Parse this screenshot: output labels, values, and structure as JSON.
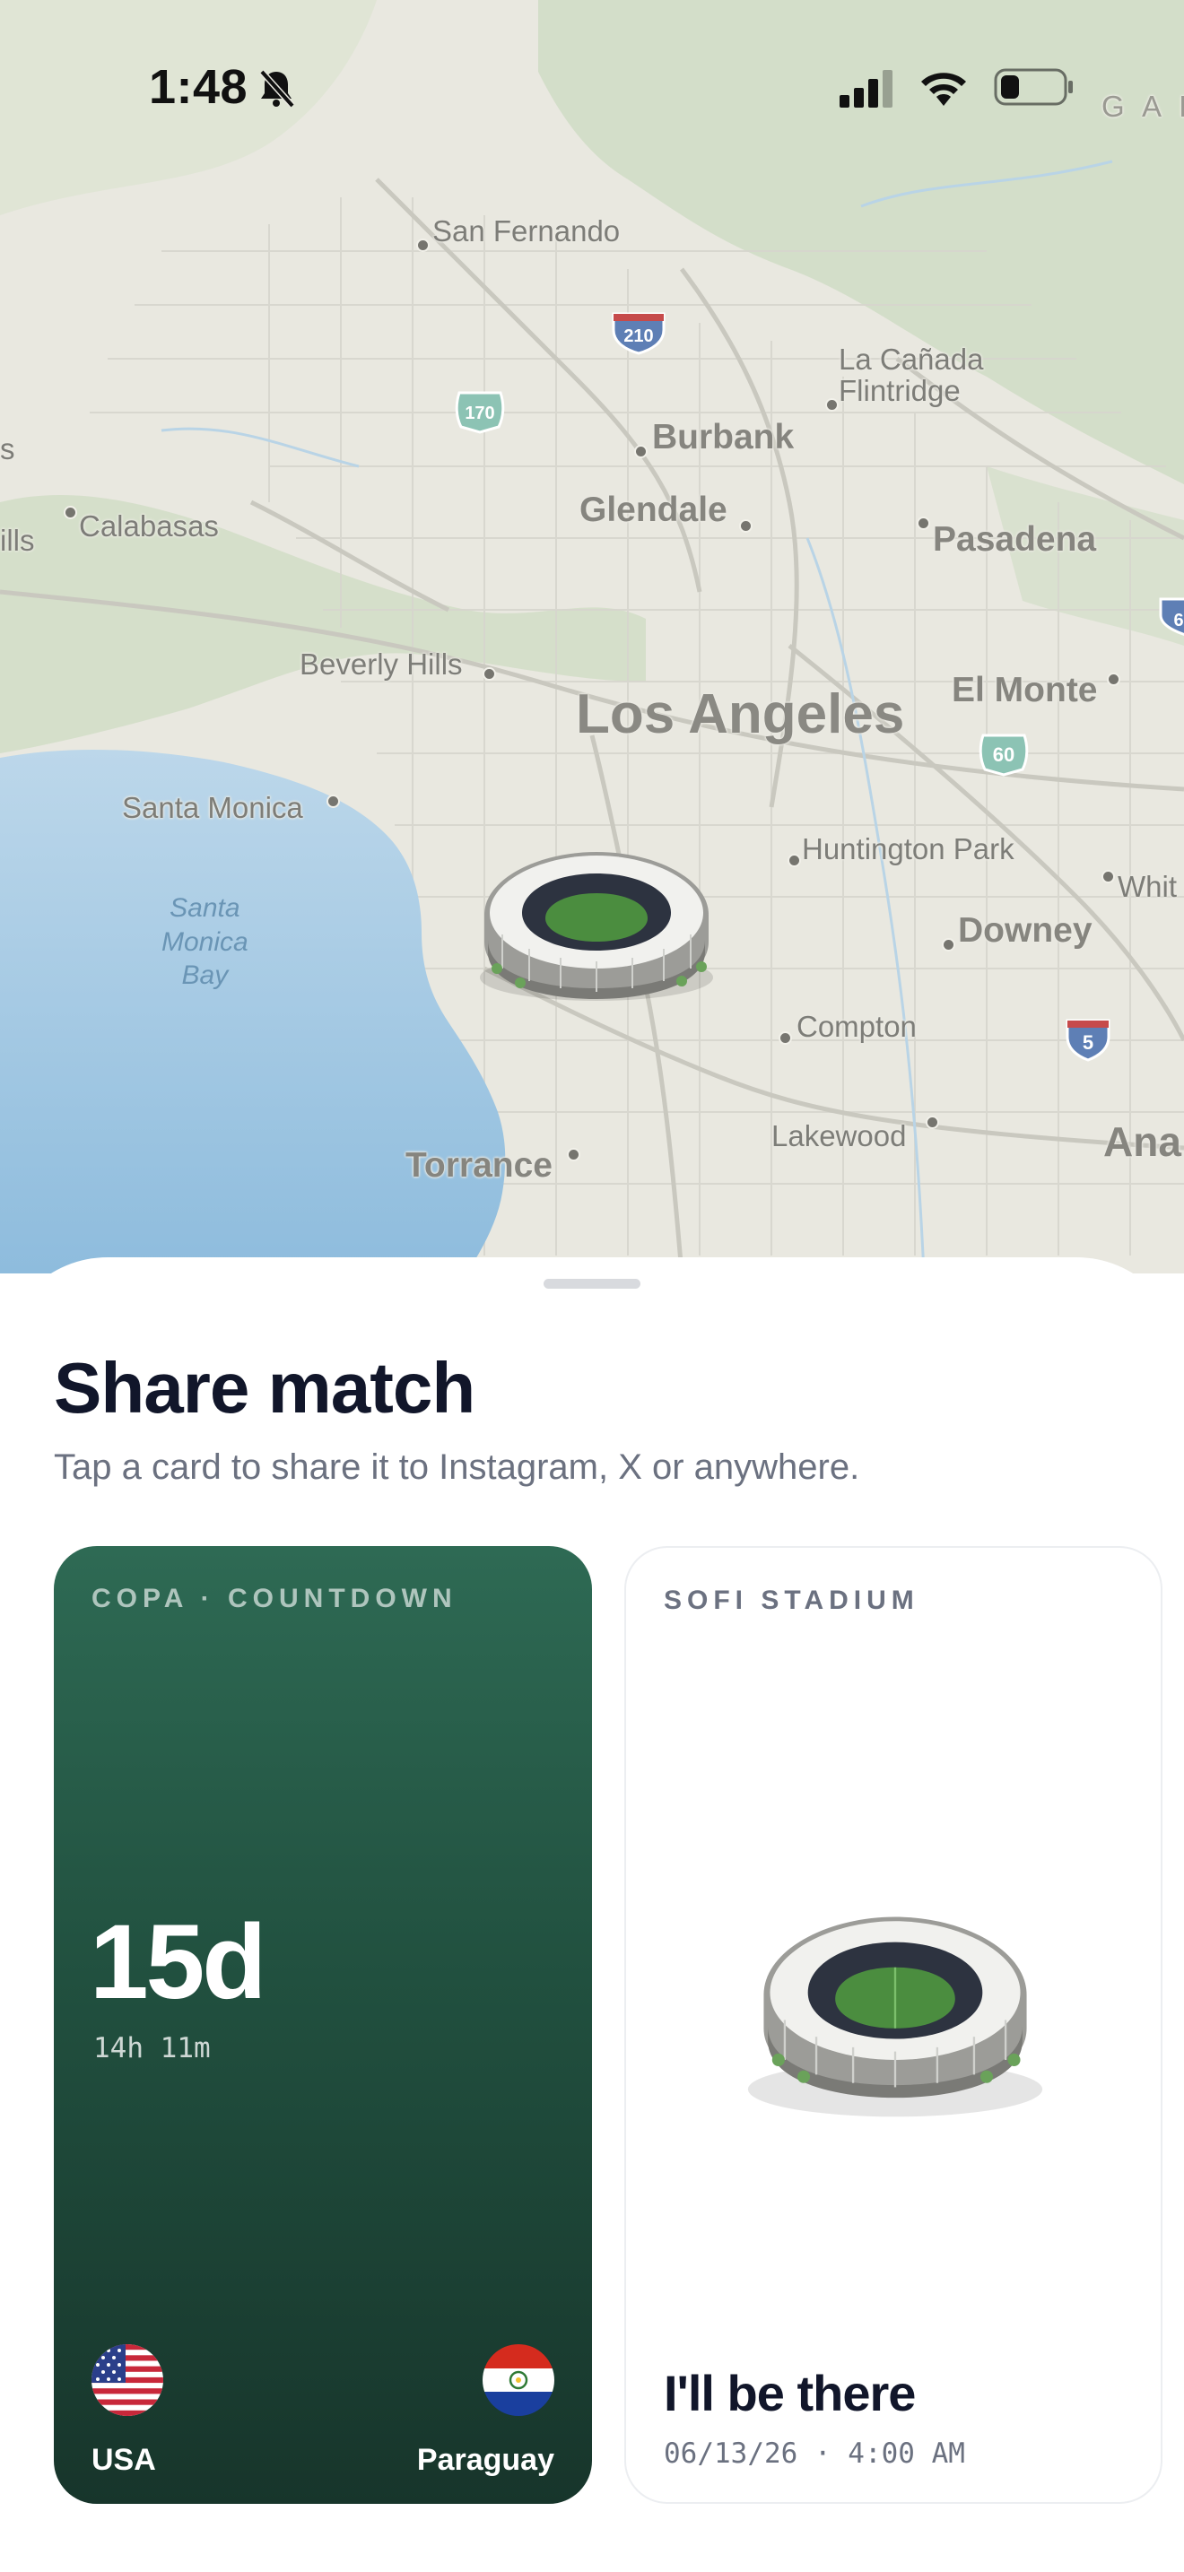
{
  "status_bar": {
    "time": "1:48",
    "icons": [
      "bell-slash-icon",
      "cellular-signal-icon",
      "wifi-icon",
      "battery-icon"
    ]
  },
  "map": {
    "places": [
      {
        "name": "San Fernando",
        "size": "sm"
      },
      {
        "name": "La Cañada\nFlintridge",
        "size": "sm"
      },
      {
        "name": "Burbank",
        "size": "md"
      },
      {
        "name": "Glendale",
        "size": "md"
      },
      {
        "name": "Pasadena",
        "size": "md"
      },
      {
        "name": "Calabasas",
        "size": "sm"
      },
      {
        "name": "Beverly Hills",
        "size": "sm"
      },
      {
        "name": "Los Angeles",
        "size": "lg"
      },
      {
        "name": "El Monte",
        "size": "md"
      },
      {
        "name": "Santa Monica",
        "size": "sm"
      },
      {
        "name": "Santa\nMonica\nBay",
        "size": "water"
      },
      {
        "name": "Huntington Park",
        "size": "sm"
      },
      {
        "name": "Whit",
        "size": "sm"
      },
      {
        "name": "Downey",
        "size": "md"
      },
      {
        "name": "Compton",
        "size": "sm"
      },
      {
        "name": "Lakewood",
        "size": "sm"
      },
      {
        "name": "Torrance",
        "size": "md"
      },
      {
        "name": "Ana",
        "size": "md"
      },
      {
        "name": "ills",
        "size": "sm"
      },
      {
        "name": "s",
        "size": "sm"
      },
      {
        "name": "G A L",
        "size": "sm"
      }
    ],
    "highway_shields": [
      "210",
      "170",
      "60",
      "5",
      "6"
    ],
    "pin": "stadium-marker"
  },
  "sheet": {
    "title": "Share match",
    "subtitle": "Tap a card to share it to Instagram, X or anywhere."
  },
  "cards": {
    "countdown": {
      "eyebrow": "COPA · COUNTDOWN",
      "days": "15d",
      "hours_minutes": "14h 11m",
      "home_team": "USA",
      "away_team": "Paraguay"
    },
    "stadium": {
      "eyebrow": "SOFI STADIUM",
      "headline": "I'll be there",
      "date_time": "06/13/26 · 4:00 AM"
    }
  },
  "colors": {
    "countdown_card_top": "#2e6a54",
    "countdown_card_bottom": "#17352b",
    "title_text": "#11162a",
    "secondary_text": "#6b7180",
    "water": "#a9cde6",
    "land": "#e9e8e0"
  }
}
